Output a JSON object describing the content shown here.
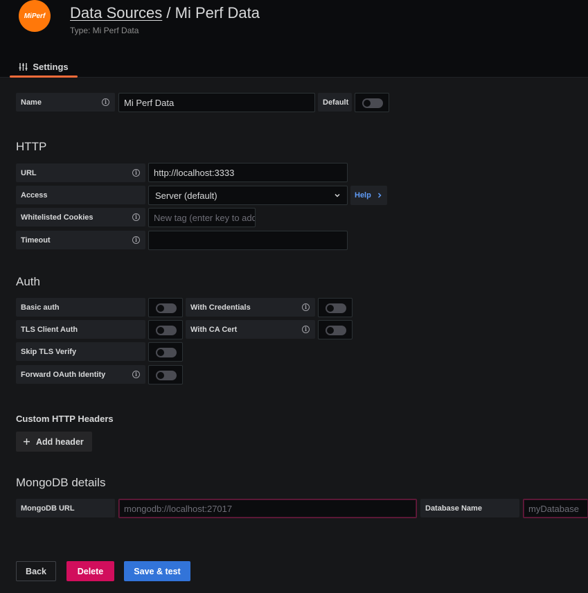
{
  "header": {
    "logo_text": "MiPerf",
    "breadcrumb": "Data Sources",
    "separator": "/",
    "title": "Mi Perf Data",
    "subtitle": "Type: Mi Perf Data",
    "tab_settings": "Settings"
  },
  "name_row": {
    "label": "Name",
    "value": "Mi Perf Data",
    "default_label": "Default",
    "default_on": false
  },
  "http": {
    "heading": "HTTP",
    "url_label": "URL",
    "url_value": "http://localhost:3333",
    "access_label": "Access",
    "access_value": "Server (default)",
    "help_label": "Help",
    "cookies_label": "Whitelisted Cookies",
    "cookies_placeholder": "New tag (enter key to add)",
    "timeout_label": "Timeout",
    "timeout_value": ""
  },
  "auth": {
    "heading": "Auth",
    "basic_auth": "Basic auth",
    "with_credentials": "With Credentials",
    "tls_client_auth": "TLS Client Auth",
    "with_ca_cert": "With CA Cert",
    "skip_tls_verify": "Skip TLS Verify",
    "forward_oauth": "Forward OAuth Identity"
  },
  "custom_headers": {
    "heading": "Custom HTTP Headers",
    "add_label": "Add header"
  },
  "mongodb": {
    "heading": "MongoDB details",
    "url_label": "MongoDB URL",
    "url_placeholder": "mongodb://localhost:27017",
    "db_label": "Database Name",
    "db_placeholder": "myDatabase"
  },
  "actions": {
    "back": "Back",
    "delete": "Delete",
    "save": "Save & test"
  },
  "colors": {
    "accent_tab": "#fa6c3a",
    "logo": "#ff780a",
    "delete": "#d10e5c",
    "primary": "#3274d9",
    "link": "#5f9bf6"
  }
}
